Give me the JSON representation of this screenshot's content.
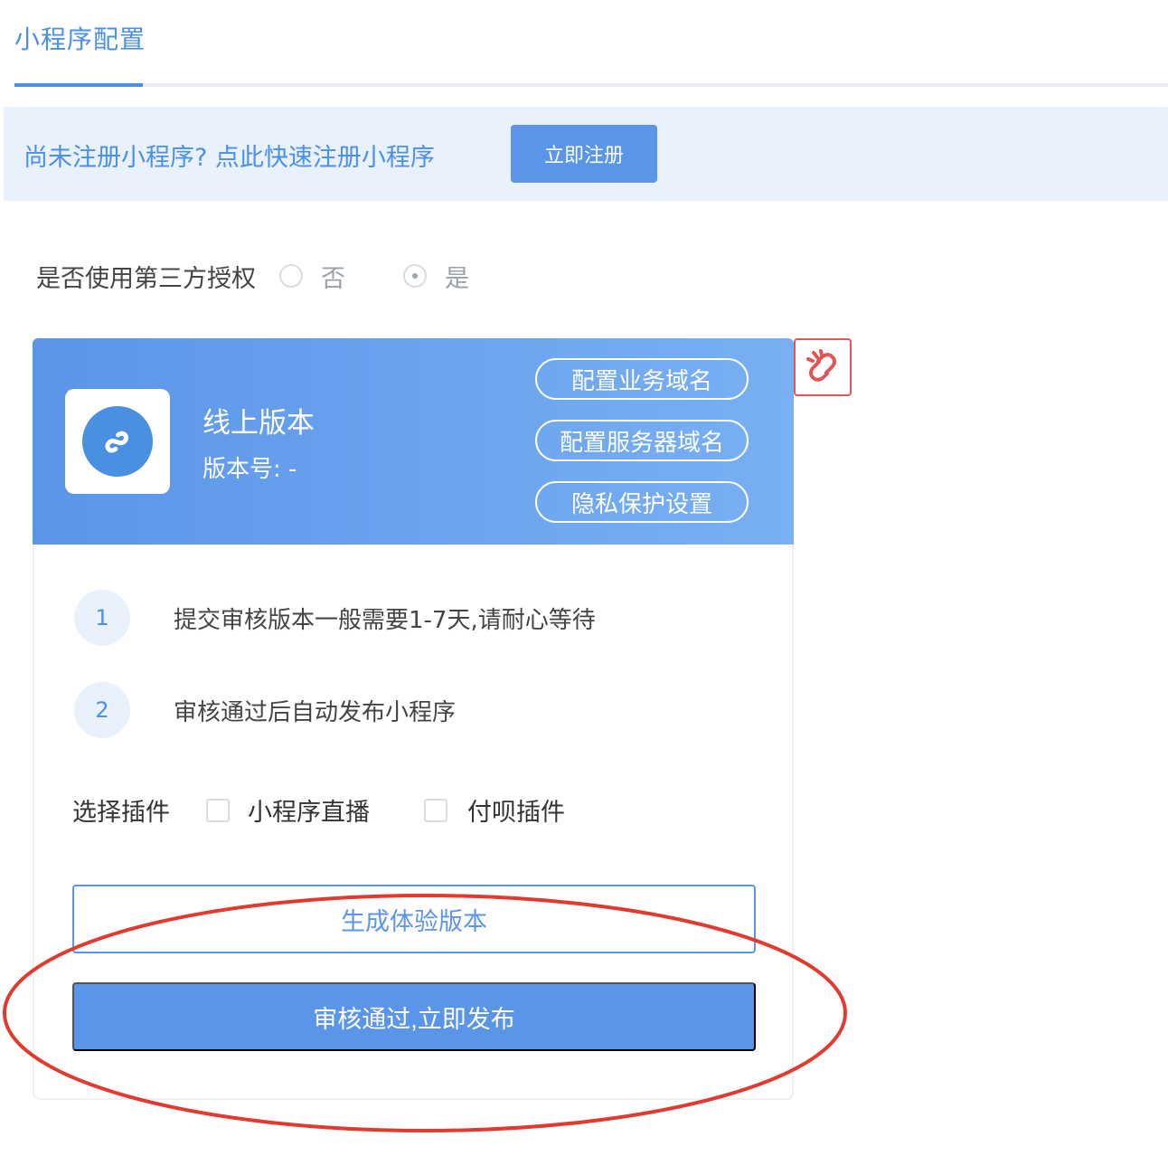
{
  "tabs": {
    "active_label": "小程序配置"
  },
  "banner": {
    "text": "尚未注册小程序?  点此快速注册小程序",
    "register_label": "立即注册"
  },
  "auth": {
    "label": "是否使用第三方授权",
    "option_no": "否",
    "option_yes": "是",
    "selected": "是"
  },
  "card": {
    "version_title": "线上版本",
    "version_number": "版本号:  -",
    "buttons": {
      "business_domain": "配置业务域名",
      "server_domain": "配置服务器域名",
      "privacy": "隐私保护设置"
    },
    "steps": [
      {
        "num": "1",
        "text": "提交审核版本一般需要1-7天,请耐心等待"
      },
      {
        "num": "2",
        "text": "审核通过后自动发布小程序"
      }
    ],
    "plugins": {
      "label": "选择插件",
      "live": "小程序直播",
      "fubei": "付呗插件"
    },
    "generate_label": "生成体验版本",
    "publish_label": "审核通过,立即发布"
  },
  "colors": {
    "accent": "#5b95e8",
    "annotation": "#e23a2f"
  },
  "icons": {
    "app": "mini-program-icon",
    "unlink": "unlink-icon"
  }
}
